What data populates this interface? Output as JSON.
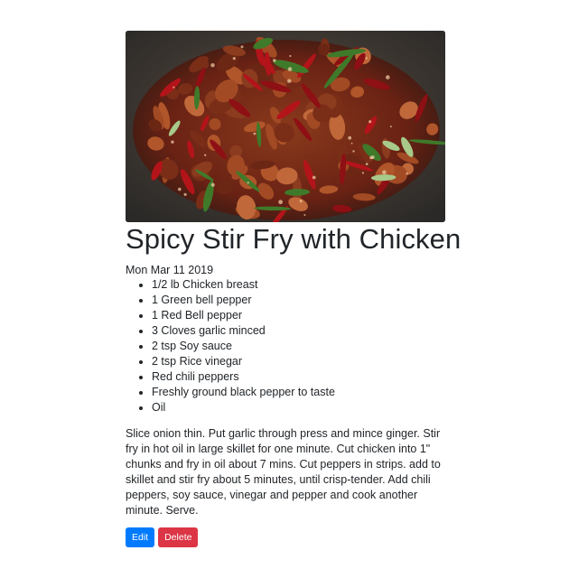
{
  "recipe": {
    "image_alt": "Spicy stir fry with chicken, chili peppers and green onion in a wok",
    "title": "Spicy Stir Fry with Chicken",
    "date": "Mon Mar 11 2019",
    "ingredients": [
      "1/2 lb Chicken breast",
      "1 Green bell pepper",
      "1 Red Bell pepper",
      "3 Cloves garlic minced",
      "2 tsp Soy sauce",
      "2 tsp Rice vinegar",
      "Red chili peppers",
      "Freshly ground black pepper to taste",
      "Oil"
    ],
    "instructions": "Slice onion thin. Put garlic through press and mince ginger. Stir fry in hot oil in large skillet for one minute. Cut chicken into 1\" chunks and fry in oil about 7 mins. Cut peppers in strips. add to skillet and stir fry about 5 minutes, until crisp-tender. Add chili peppers, soy sauce, vinegar and pepper and cook another minute. Serve."
  },
  "actions": {
    "edit_label": "Edit",
    "delete_label": "Delete"
  },
  "colors": {
    "edit": "#007bff",
    "delete": "#dc3545",
    "text": "#212529"
  }
}
